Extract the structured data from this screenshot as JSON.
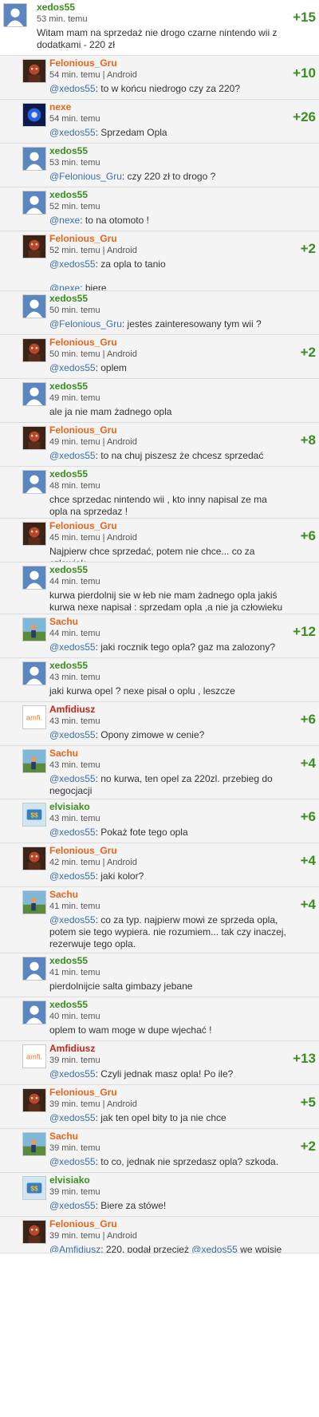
{
  "colors": {
    "score": "#3b8e1f",
    "author_green": "#3a8f1e",
    "author_orange": "#e8641c",
    "author_red": "#c0281a",
    "mention": "#3a6fa8"
  },
  "entries": [
    {
      "author": "xedos55",
      "color": "green",
      "avatar": "default-avatar",
      "meta": "53 min. temu",
      "score": "+15",
      "text": "Witam mam na sprzedaż nie drogo czarne nintendo wii z dodatkami - 220 zł",
      "mention": ""
    },
    {
      "author": "Felonious_Gru",
      "color": "orange",
      "avatar": "gru-avatar",
      "meta": "54 min. temu | Android",
      "score": "+10",
      "mention": "@xedos55",
      "text": ": to w końcu niedrogo czy za 220?"
    },
    {
      "author": "nexe",
      "color": "orange",
      "avatar": "nexe-avatar",
      "meta": "54 min. temu",
      "score": "+26",
      "mention": "@xedos55",
      "text": ": Sprzedam Opla"
    },
    {
      "author": "xedos55",
      "color": "green",
      "avatar": "default-avatar",
      "meta": "53 min. temu",
      "score": "",
      "mention": "@Felonious_Gru",
      "text": ": czy 220 zł to drogo ?"
    },
    {
      "author": "xedos55",
      "color": "green",
      "avatar": "default-avatar",
      "meta": "52 min. temu",
      "score": "",
      "mention": "@nexe",
      "text": ": to na otomoto !"
    },
    {
      "author": "Felonious_Gru",
      "color": "orange",
      "avatar": "gru-avatar",
      "meta": "52 min. temu | Android",
      "score": "+2",
      "mention": "@xedos55",
      "text": ": za opla to tanio",
      "mention2": "@nexe",
      "text2": ": biere"
    },
    {
      "author": "xedos55",
      "color": "green",
      "avatar": "default-avatar",
      "meta": "50 min. temu",
      "score": "",
      "mention": "@Felonious_Gru",
      "text": ": jestes zainteresowany tym wii ?"
    },
    {
      "author": "Felonious_Gru",
      "color": "orange",
      "avatar": "gru-avatar",
      "meta": "50 min. temu | Android",
      "score": "+2",
      "mention": "@xedos55",
      "text": ": oplem"
    },
    {
      "author": "xedos55",
      "color": "green",
      "avatar": "default-avatar",
      "meta": "49 min. temu",
      "score": "",
      "mention": "",
      "text": "ale ja nie mam żadnego opla"
    },
    {
      "author": "Felonious_Gru",
      "color": "orange",
      "avatar": "gru-avatar",
      "meta": "49 min. temu | Android",
      "score": "+8",
      "mention": "@xedos55",
      "text": ": to na chuj piszesz że chcesz sprzedać"
    },
    {
      "author": "xedos55",
      "color": "green",
      "avatar": "default-avatar",
      "meta": "48 min. temu",
      "score": "",
      "mention": "",
      "text": "chce sprzedac nintendo wii , kto inny napisal ze ma opla na sprzedaz !"
    },
    {
      "author": "Felonious_Gru",
      "color": "orange",
      "avatar": "gru-avatar",
      "meta": "45 min. temu | Android",
      "score": "+6",
      "mention": "",
      "text": "Najpierw chce sprzedać, potem nie chce... co za człowiek"
    },
    {
      "author": "xedos55",
      "color": "green",
      "avatar": "default-avatar",
      "meta": "44 min. temu",
      "score": "",
      "mention": "",
      "text": "kurwa pierdolnij sie w łeb nie mam żadnego opla jakiś kurwa nexe napisał : sprzedam opla ,a nie ja człowieku !!!!!!"
    },
    {
      "author": "Sachu",
      "color": "orange",
      "avatar": "sachu-avatar",
      "meta": "44 min. temu",
      "score": "+12",
      "mention": "@xedos55",
      "text": ": jaki rocznik tego opla? gaz ma zalozony?"
    },
    {
      "author": "xedos55",
      "color": "green",
      "avatar": "default-avatar",
      "meta": "43 min. temu",
      "score": "",
      "mention": "",
      "text": "jaki kurwa opel ? nexe pisał o oplu , leszcze"
    },
    {
      "author": "Amfidiusz",
      "color": "red",
      "avatar": "amfi-avatar",
      "meta": "43 min. temu",
      "score": "+6",
      "mention": "@xedos55",
      "text": ": Opony zimowe w cenie?"
    },
    {
      "author": "Sachu",
      "color": "orange",
      "avatar": "sachu-avatar",
      "meta": "43 min. temu",
      "score": "+4",
      "mention": "@xedos55",
      "text": ": no kurwa, ten opel za 220zl. przebieg do negocjacji"
    },
    {
      "author": "elvisiako",
      "color": "green",
      "avatar": "elvis-avatar",
      "meta": "43 min. temu",
      "score": "+6",
      "mention": "@xedos55",
      "text": ": Pokaż fote tego opla"
    },
    {
      "author": "Felonious_Gru",
      "color": "orange",
      "avatar": "gru-avatar",
      "meta": "42 min. temu | Android",
      "score": "+4",
      "mention": "@xedos55",
      "text": ": jaki kolor?"
    },
    {
      "author": "Sachu",
      "color": "orange",
      "avatar": "sachu-avatar",
      "meta": "41 min. temu",
      "score": "+4",
      "mention": "@xedos55",
      "text": ": co za typ. najpierw mowi ze sprzeda opla, potem sie tego wypiera. nie rozumiem... tak czy inaczej, rezerwuje tego opla."
    },
    {
      "author": "xedos55",
      "color": "green",
      "avatar": "default-avatar",
      "meta": "41 min. temu",
      "score": "",
      "mention": "",
      "text": "pierdolnijcie salta gimbazy jebane"
    },
    {
      "author": "xedos55",
      "color": "green",
      "avatar": "default-avatar",
      "meta": "40 min. temu",
      "score": "",
      "mention": "",
      "text": "oplem to wam moge w dupe wjechać !"
    },
    {
      "author": "Amfidiusz",
      "color": "red",
      "avatar": "amfi-avatar",
      "meta": "39 min. temu",
      "score": "+13",
      "mention": "@xedos55",
      "text": ": Czyli jednak masz opla! Po ile?"
    },
    {
      "author": "Felonious_Gru",
      "color": "orange",
      "avatar": "gru-avatar",
      "meta": "39 min. temu | Android",
      "score": "+5",
      "mention": "@xedos55",
      "text": ": jak ten opel bity to ja nie chce"
    },
    {
      "author": "Sachu",
      "color": "orange",
      "avatar": "sachu-avatar",
      "meta": "39 min. temu",
      "score": "+2",
      "mention": "@xedos55",
      "text": ": to co, jednak nie sprzedasz opla? szkoda."
    },
    {
      "author": "elvisiako",
      "color": "green",
      "avatar": "elvis-avatar",
      "meta": "39 min. temu",
      "score": "",
      "mention": "@xedos55",
      "text": ": Biere za stówe!"
    },
    {
      "author": "Felonious_Gru",
      "color": "orange",
      "avatar": "gru-avatar",
      "meta": "39 min. temu | Android",
      "score": "",
      "mention": "@Amfidiusz",
      "text": ": 220, podał przecież ",
      "mention3": "@xedos55",
      "text3": " we wpisie"
    }
  ]
}
